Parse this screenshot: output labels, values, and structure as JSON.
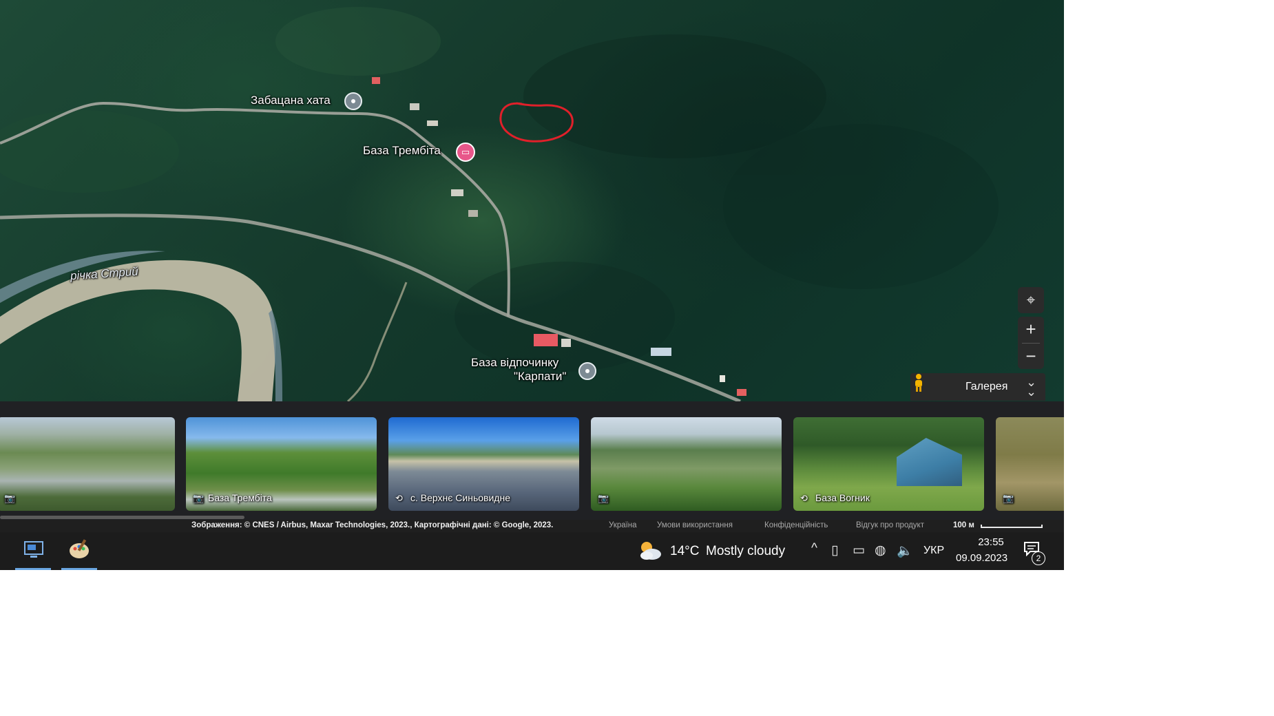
{
  "map": {
    "labels": {
      "zabatsana": "Забацана хата",
      "trembita": "База Трембіта",
      "karpaty_line1": "База відпочинку",
      "karpaty_line2": "\"Карпати\"",
      "river": "річка Стрий"
    },
    "icons": {
      "place": "place-dot-icon",
      "hotel": "hotel-bed-icon",
      "locate": "my-location-icon",
      "pegman": "street-view-pegman-icon",
      "expand": "double-chevron-down-icon"
    },
    "controls": {
      "zoom_in": "+",
      "zoom_out": "−",
      "locate": "⌖"
    },
    "gallery_label": "Галерея",
    "annotation_color": "#e0202a"
  },
  "gallery": {
    "photos": [
      {
        "caption": "",
        "icon": "camera-icon"
      },
      {
        "caption": "База Трембіта",
        "icon": "camera-icon"
      },
      {
        "caption": "с. Верхнє Синьовидне",
        "icon": "panorama-360-icon"
      },
      {
        "caption": "",
        "icon": "camera-icon"
      },
      {
        "caption": "База Вогник",
        "icon": "panorama-360-icon"
      },
      {
        "caption": "",
        "icon": "camera-icon"
      }
    ]
  },
  "attribution": {
    "imagery": "Зображення: © CNES / Airbus, Maxar Technologies, 2023., Картографічні дані: © Google, 2023.",
    "country": "Україна",
    "terms": "Умови використання",
    "privacy": "Конфіденційність",
    "feedback": "Відгук про продукт",
    "scale": "100 м"
  },
  "taskbar": {
    "apps": [
      "remote-desktop-icon",
      "paint-icon"
    ],
    "weather_icon": "partly-cloudy-icon",
    "temperature": "14°C",
    "weather": "Mostly cloudy",
    "tray": {
      "chevron": "^",
      "icons": [
        "tablet-icon",
        "battery-icon",
        "network-globe-icon",
        "volume-icon"
      ]
    },
    "language": "УКР",
    "time": "23:55",
    "date": "09.09.2023",
    "notification_count": "2"
  }
}
